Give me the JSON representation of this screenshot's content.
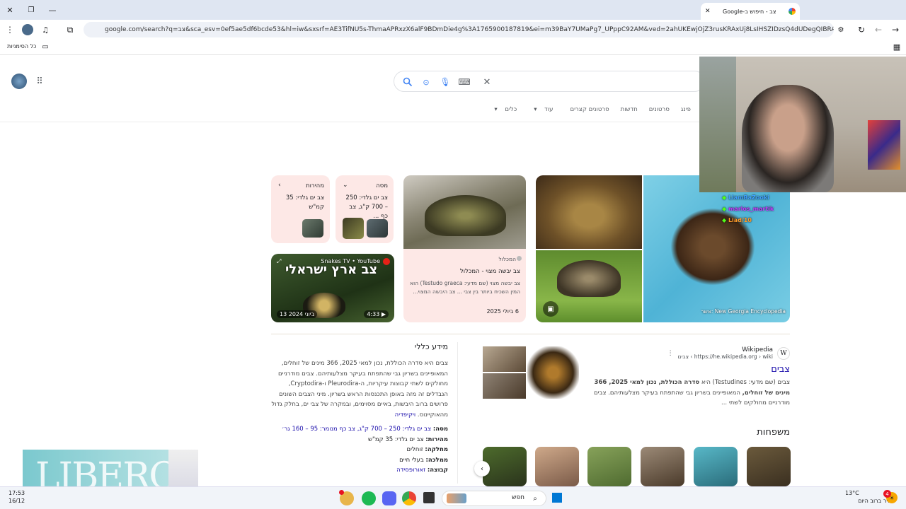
{
  "browser": {
    "tab_title": "צב - חיפוש ב-Google",
    "url": "google.com/search?q=צב&sca_esv=0ef5ae5df6bcde53&hl=iw&sxsrf=AE3TifNU5s-ThmaAPRxzX6alF9BDmDie4g%3A1765900187819&ei=m39BaY7UMaPg7_UPppC92AM&ved=2ahUKEwjOjZ3rusKRAxUj8LsIHSZIDzsQ4dUDegQIBRAN&uact=5&oq=...",
    "bookmarks_label": "כל הסימניות"
  },
  "search": {
    "nav_tabs": [
      "פינג",
      "סרטונים",
      "חדשות",
      "סרטונים קצרים",
      "עוד",
      "כלים"
    ]
  },
  "facts": {
    "weight_title": "מסה",
    "weight_text": "צב ים גלדי: 250 – 700 ק\"ג, צב כף ...",
    "speed_title": "מהירות",
    "speed_text": "צב ים גלדי: 35 קמ\"ש"
  },
  "article_card": {
    "source": "המכלול",
    "title": "צב יבשה מצוי - המכלול",
    "snippet": "צב יבשה מצוי (שם מדעי: Testudo graeca) הוא המין השכיח ביותר בין צבי ... צב היבשה המצוי...",
    "date": "6 ביולי 2025"
  },
  "video_card": {
    "channel": "Snakes TV • YouTube",
    "overlay": "צב ארץ ישראלי",
    "duration": "4:33",
    "date": "13 ביוני 2024"
  },
  "image_credit": "New Georgia Encyclopedia :אשר",
  "wiki": {
    "source_name": "Wikipedia",
    "breadcrumb": "https://he.wikipedia.org › wiki › צבים",
    "title": "צבים",
    "snippet_a": "צבים (שם מדעי: Testudines) היא",
    "snippet_b": "סדרה הכוללת, נכון למאי 2025, 366 מינים של זוחלים,",
    "snippet_c": "המאופיינים בשריון גבי שהתפתח בעיקר מצלעותיהם. צבים מודרניים מחולקים לשתי ...",
    "families_heading": "משפחות"
  },
  "kp": {
    "heading": "מידע כללי",
    "body": "צבים היא סדרה הכוללת, נכון למאי 2025, 366 מינים של זוחלים, המאופיינים בשריון גבי שהתפתח בעיקר מצלעותיהם. צבים מודרניים מחולקים לשתי קבוצות עיקריות, ה-Pleurodira ו-Cryptodira, הנבדלים זה מזה באופן התכנסות הראש בשריון. מיני הצבים השונים פרושים ברוב היבשות, באיים מסוימים, ובמקרה של צבי ים, בחלק גדול מהאוקיינוס.",
    "wiki_link": "ויקיפדיה",
    "rows": [
      {
        "label": "מסה:",
        "value": "צב ים גלדי: 250 – 700 ק\"ג, צב כף מנומר: 95 – 160 גר׳"
      },
      {
        "label": "מהירות:",
        "value": "צב ים גלדי: 35 קמ\"ש"
      },
      {
        "label": "מחלקה:",
        "value": "זוחלים"
      },
      {
        "label": "ממלכה:",
        "value": "בעלי חיים"
      },
      {
        "label": "קבוצה:",
        "value": "זאורופסידה"
      }
    ]
  },
  "chat": {
    "users": [
      "LiamBaZooki",
      "marlos_martik",
      "Liad/10"
    ]
  },
  "overlay_logo": "LIBERO",
  "taskbar": {
    "search_placeholder": "חפש",
    "time": "17:53",
    "date": "16/12",
    "weather_temp": "13°C",
    "weather_desc": "בהיר ברוב היום",
    "notif_count": "4"
  },
  "colors": {
    "accent_link": "#1a0dab",
    "pink_card": "#fde8e6",
    "chrome_bg": "#dfe6f2"
  }
}
